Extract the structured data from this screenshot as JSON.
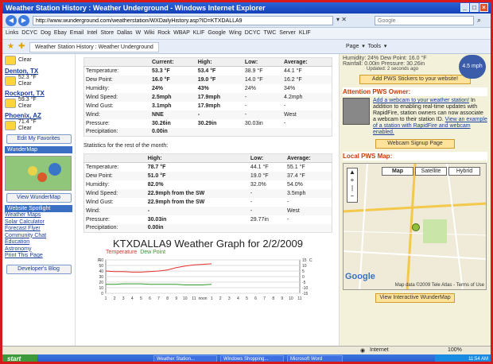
{
  "window": {
    "title": "Weather Station History : Weather Underground - Windows Internet Explorer"
  },
  "browser": {
    "url": "http://www.wunderground.com/weatherstation/WXDailyHistory.asp?ID=KTXDALLA9",
    "search_placeholder": "Google",
    "tab_title": "Weather Station History : Weather Underground",
    "addr_controls": "▾  ✕",
    "tools": "Page ▾  Tools ▾"
  },
  "links": [
    "Links",
    "DCYC",
    "Dog",
    "Ebay",
    "Email",
    "Intel",
    "Store",
    "Dallas",
    "W Wiki",
    "Rock",
    "WBAP",
    "KLIF",
    "Google",
    "Wing DCYC",
    "TWC Server",
    "KLIF"
  ],
  "sidebar": {
    "cities": [
      {
        "name": "",
        "temp": "",
        "cond": "Clear"
      },
      {
        "name": "Denton, TX",
        "temp": "52.3 °F",
        "cond": "Clear"
      },
      {
        "name": "Rockport, TX",
        "temp": "59.3 °F",
        "cond": "Clear"
      },
      {
        "name": "Phoenix, AZ",
        "temp": "71.4 °F",
        "cond": "Clear"
      }
    ],
    "edit_favorites": "Edit My Favorites",
    "wundermap_head": "WunderMap",
    "view_wundermap": "View WunderMap",
    "spotlight_head": "Website Spotlight",
    "spotlight_links": [
      "Weather Maps",
      "Solar Calculator",
      "Forecast Flyer",
      "Community Chat",
      "Education",
      "Astronomy",
      "Print This Page"
    ],
    "dev_blog": "Developer's Blog"
  },
  "current_table": {
    "headers": [
      "",
      "Current:",
      "High:",
      "Low:",
      "Average:"
    ],
    "rows": [
      [
        "Temperature:",
        "53.3 °F",
        "53.4 °F",
        "38.9 °F",
        "44.1 °F"
      ],
      [
        "Dew Point:",
        "16.0 °F",
        "19.0 °F",
        "14.0 °F",
        "16.2 °F"
      ],
      [
        "Humidity:",
        "24%",
        "43%",
        "24%",
        "34%"
      ],
      [
        "Wind Speed:",
        "2.5mph",
        "17.9mph",
        "-",
        "4.2mph"
      ],
      [
        "Wind Gust:",
        "3.1mph",
        "17.9mph",
        "-",
        "-"
      ],
      [
        "Wind:",
        "NNE",
        "-",
        "-",
        "West"
      ],
      [
        "Pressure:",
        "30.26in",
        "30.29in",
        "30.03in",
        "-"
      ],
      [
        "Precipitation:",
        "0.00in",
        "",
        "",
        ""
      ]
    ]
  },
  "stats_line": "Statistics for the rest of the month:",
  "month_table": {
    "headers": [
      "",
      "High:",
      "Low:",
      "Average:"
    ],
    "rows": [
      [
        "Temperature:",
        "78.7 °F",
        "44.1 °F",
        "55.1 °F"
      ],
      [
        "Dew Point:",
        "51.0 °F",
        "19.0 °F",
        "37.4 °F"
      ],
      [
        "Humidity:",
        "82.0%",
        "32.0%",
        "54.0%"
      ],
      [
        "Wind Speed:",
        "22.9mph from the SW",
        "-",
        "3.5mph"
      ],
      [
        "Wind Gust:",
        "22.9mph from the SW",
        "-",
        "-"
      ],
      [
        "Wind:",
        "-",
        "-",
        "West"
      ],
      [
        "Pressure:",
        "30.03in",
        "29.77in",
        "-"
      ],
      [
        "Precipitation:",
        "0.00in",
        "",
        ""
      ]
    ]
  },
  "chart_data": {
    "type": "line",
    "title": "KTXDALLA9 Weather Graph for 2/2/2009",
    "series": [
      {
        "name": "Temperature",
        "color": "#e53030",
        "values": [
          40,
          39,
          39,
          38,
          38,
          39,
          40,
          42,
          46,
          49,
          51,
          52,
          53
        ]
      },
      {
        "name": "Dew Point",
        "color": "#2e9a2e",
        "values": [
          16,
          16,
          17,
          17,
          17,
          16,
          16,
          16,
          16,
          15,
          15,
          15,
          16
        ]
      }
    ],
    "ylim": [
      0,
      60
    ],
    "ylabel": "F",
    "y2label": "C",
    "x_ticks": [
      "1",
      "2",
      "3",
      "4",
      "5",
      "6",
      "7",
      "8",
      "9",
      "10",
      "11",
      "noon",
      "1",
      "2",
      "3",
      "4",
      "5",
      "6",
      "7",
      "8",
      "9",
      "10",
      "11"
    ],
    "y_ticks": [
      "60",
      "50",
      "40",
      "30",
      "20",
      "10",
      "0"
    ],
    "y2_ticks": [
      "15",
      "10",
      "5",
      "0",
      "-5",
      "-10",
      "-15"
    ]
  },
  "right": {
    "humidity_line": "Humidity: 24%  Dew Point: 16.0 °F",
    "rainfall_line": "Rainfall: 0.00in  Pressure: 30.26in",
    "updated": "Updated: 2 seconds ago",
    "moon": "4.5 mph",
    "sticker_btn": "Add PWS Stickers to your website!",
    "attention_head": "Attention PWS Owner:",
    "cam_link": "Add a webcam to your weather station!",
    "cam_text": "In addition to enabling real-time updates with RapidFire, station owners can now associate a webcam to their station ID.",
    "cam_link2": "View an example of a station with RapidFire and webcam enabled.",
    "signup_btn": "Webcam Signup Page",
    "map_head": "Local PWS Map:",
    "map_tabs": [
      "Map",
      "Satellite",
      "Hybrid"
    ],
    "map_credit": "Map data ©2009 Tele Atlas - Terms of Use",
    "google": "Google",
    "view_interactive": "View Interactive WunderMap"
  },
  "status": {
    "left": "",
    "zone": "Internet",
    "zoom": "100%"
  },
  "taskbar": {
    "start": "start",
    "tasks": [
      "Weather Station...",
      "Windows Shopping...",
      "Microsoft Word"
    ],
    "clock": "11:54 AM"
  }
}
